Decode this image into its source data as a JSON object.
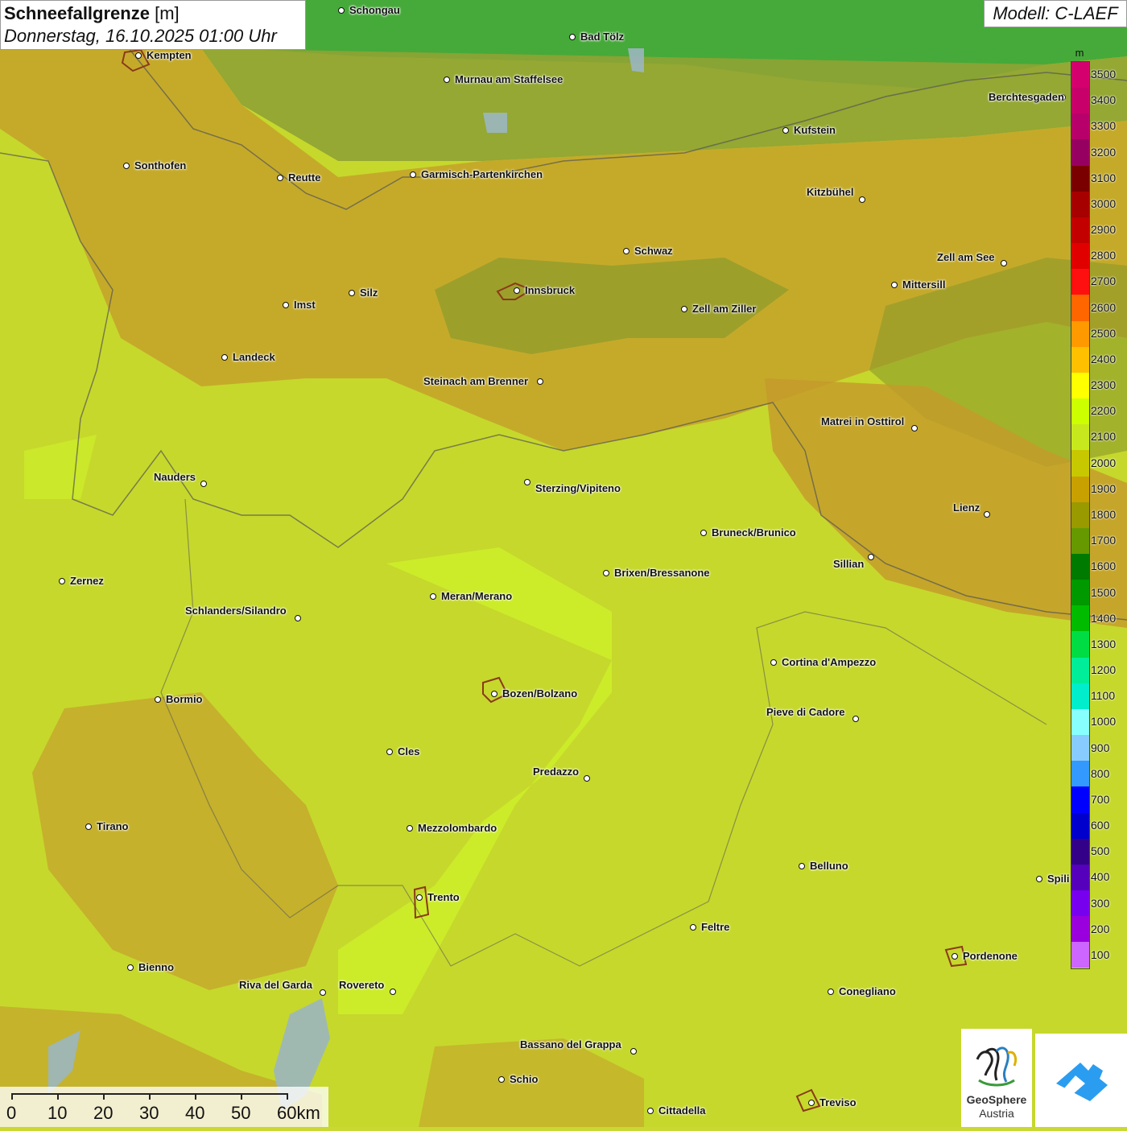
{
  "header": {
    "title": "Schneefallgrenze",
    "unit": "[m]",
    "datetime": "Donnerstag, 16.10.2025 01:00 Uhr"
  },
  "model": {
    "label": "Modell: C-LAEF"
  },
  "cities": [
    {
      "name": "Schongau",
      "label_side": "right"
    },
    {
      "name": "Bad Tölz",
      "label_side": "right"
    },
    {
      "name": "Kempten",
      "label_side": "right"
    },
    {
      "name": "Murnau am Staffelsee",
      "label_side": "right"
    },
    {
      "name": "Berchtesgaden",
      "label_side": "left"
    },
    {
      "name": "Kufstein",
      "label_side": "right"
    },
    {
      "name": "Sonthofen",
      "label_side": "right"
    },
    {
      "name": "Reutte",
      "label_side": "right"
    },
    {
      "name": "Garmisch-Partenkirchen",
      "label_side": "right"
    },
    {
      "name": "Kitzbühel",
      "label_side": "left"
    },
    {
      "name": "Schwaz",
      "label_side": "right"
    },
    {
      "name": "Zell am See",
      "label_side": "left"
    },
    {
      "name": "Mittersill",
      "label_side": "right"
    },
    {
      "name": "Innsbruck",
      "label_side": "right"
    },
    {
      "name": "Silz",
      "label_side": "right"
    },
    {
      "name": "Imst",
      "label_side": "right"
    },
    {
      "name": "Zell am Ziller",
      "label_side": "right"
    },
    {
      "name": "Landeck",
      "label_side": "right"
    },
    {
      "name": "Steinach am Brenner",
      "label_side": "left"
    },
    {
      "name": "Matrei in Osttirol",
      "label_side": "left"
    },
    {
      "name": "Nauders",
      "label_side": "left"
    },
    {
      "name": "Sterzing/Vipiteno",
      "label_side": "right"
    },
    {
      "name": "Lienz",
      "label_side": "left"
    },
    {
      "name": "Bruneck/Brunico",
      "label_side": "right"
    },
    {
      "name": "Sillian",
      "label_side": "left"
    },
    {
      "name": "Zernez",
      "label_side": "right"
    },
    {
      "name": "Brixen/Bressanone",
      "label_side": "right"
    },
    {
      "name": "Meran/Merano",
      "label_side": "right"
    },
    {
      "name": "Schlanders/Silandro",
      "label_side": "left"
    },
    {
      "name": "Cortina d'Ampezzo",
      "label_side": "right"
    },
    {
      "name": "Bozen/Bolzano",
      "label_side": "right"
    },
    {
      "name": "Bormio",
      "label_side": "right"
    },
    {
      "name": "Pieve di Cadore",
      "label_side": "left"
    },
    {
      "name": "Cles",
      "label_side": "right"
    },
    {
      "name": "Predazzo",
      "label_side": "left"
    },
    {
      "name": "Tirano",
      "label_side": "right"
    },
    {
      "name": "Mezzolombardo",
      "label_side": "right"
    },
    {
      "name": "Belluno",
      "label_side": "right"
    },
    {
      "name": "Spili",
      "label_side": "right"
    },
    {
      "name": "Trento",
      "label_side": "right"
    },
    {
      "name": "Feltre",
      "label_side": "right"
    },
    {
      "name": "Pordenone",
      "label_side": "right"
    },
    {
      "name": "Bienno",
      "label_side": "right"
    },
    {
      "name": "Riva del Garda",
      "label_side": "left"
    },
    {
      "name": "Rovereto",
      "label_side": "left"
    },
    {
      "name": "Conegliano",
      "label_side": "right"
    },
    {
      "name": "Bassano del Grappa",
      "label_side": "left"
    },
    {
      "name": "Schio",
      "label_side": "right"
    },
    {
      "name": "Treviso",
      "label_side": "right"
    },
    {
      "name": "Cittadella",
      "label_side": "right"
    }
  ],
  "legend": {
    "unit": "m",
    "levels": [
      {
        "label": "3500",
        "color": "#d4006e"
      },
      {
        "label": "3400",
        "color": "#c8006a"
      },
      {
        "label": "3300",
        "color": "#b8006a"
      },
      {
        "label": "3200",
        "color": "#960060"
      },
      {
        "label": "3100",
        "color": "#7a0000"
      },
      {
        "label": "3000",
        "color": "#a60000"
      },
      {
        "label": "2900",
        "color": "#c20000"
      },
      {
        "label": "2800",
        "color": "#e00000"
      },
      {
        "label": "2700",
        "color": "#ff1010"
      },
      {
        "label": "2600",
        "color": "#ff6600"
      },
      {
        "label": "2500",
        "color": "#ff9900"
      },
      {
        "label": "2400",
        "color": "#ffc000"
      },
      {
        "label": "2300",
        "color": "#ffff00"
      },
      {
        "label": "2200",
        "color": "#ccff00"
      },
      {
        "label": "2100",
        "color": "#c8e81e"
      },
      {
        "label": "2000",
        "color": "#c8c800"
      },
      {
        "label": "1900",
        "color": "#c8a000"
      },
      {
        "label": "1800",
        "color": "#999900"
      },
      {
        "label": "1700",
        "color": "#669900"
      },
      {
        "label": "1600",
        "color": "#007a00"
      },
      {
        "label": "1500",
        "color": "#009900"
      },
      {
        "label": "1400",
        "color": "#00bb00"
      },
      {
        "label": "1300",
        "color": "#00dd44"
      },
      {
        "label": "1200",
        "color": "#00ee99"
      },
      {
        "label": "1100",
        "color": "#00eecc"
      },
      {
        "label": "1000",
        "color": "#88ffff"
      },
      {
        "label": "900",
        "color": "#88ccff"
      },
      {
        "label": "800",
        "color": "#3399ff"
      },
      {
        "label": "700",
        "color": "#0000ff"
      },
      {
        "label": "600",
        "color": "#0000cc"
      },
      {
        "label": "500",
        "color": "#330088"
      },
      {
        "label": "400",
        "color": "#5500bb"
      },
      {
        "label": "300",
        "color": "#7700ee"
      },
      {
        "label": "200",
        "color": "#9900dd"
      },
      {
        "label": "100",
        "color": "#cc66ff"
      }
    ]
  },
  "scale": {
    "labels": [
      "0",
      "10",
      "20",
      "30",
      "40",
      "50",
      "60km"
    ]
  },
  "logo": {
    "line1": "GeoSphere",
    "line2": "Austria",
    "icon": "geosphere-logo-icon"
  },
  "app_badge": {
    "icon": "warn-app-icon"
  }
}
